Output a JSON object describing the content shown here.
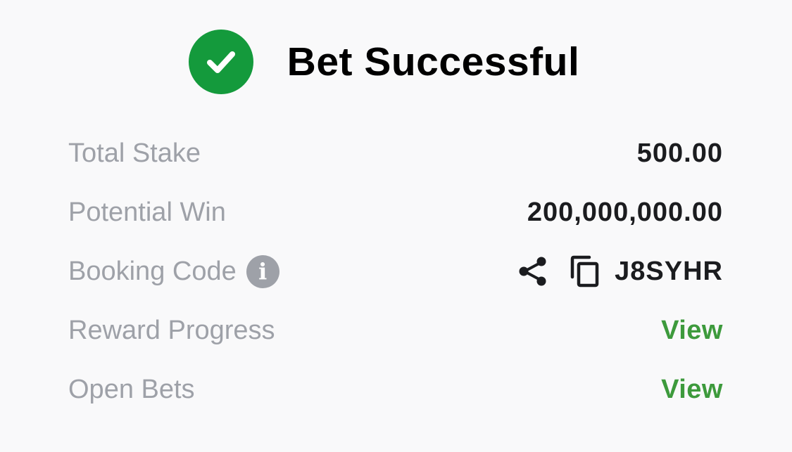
{
  "header": {
    "title": "Bet Successful",
    "icon": "check-circle-icon",
    "icon_color": "#149a3c"
  },
  "rows": [
    {
      "label": "Total Stake",
      "value": "500.00"
    },
    {
      "label": "Potential Win",
      "value": "200,000,000.00"
    },
    {
      "label": "Booking Code",
      "value": "J8SYHR",
      "label_icon": "info-icon",
      "actions": [
        "share-icon",
        "copy-icon"
      ],
      "info_glyph": "i"
    },
    {
      "label": "Reward Progress",
      "value": "View"
    },
    {
      "label": "Open Bets",
      "value": "View"
    }
  ],
  "colors": {
    "label": "#9ea1a8",
    "value": "#1b1c1f",
    "link": "#3d9a3c",
    "background": "#f9f9fa"
  }
}
